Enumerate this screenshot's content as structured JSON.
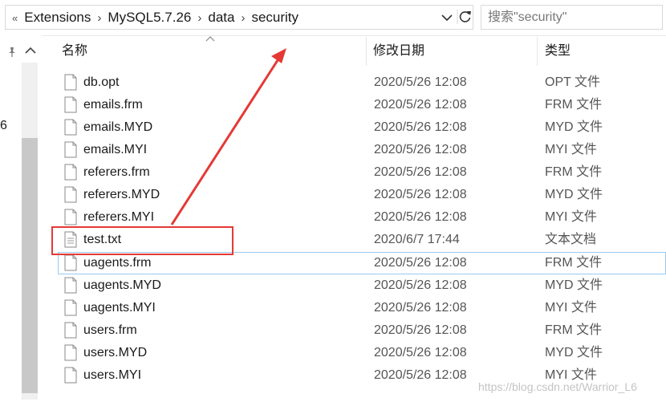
{
  "address_bar": {
    "lead_glyph": "«",
    "breadcrumbs": [
      "Extensions",
      "MySQL5.7.26",
      "data",
      "security"
    ]
  },
  "search": {
    "placeholder": "搜索\"security\""
  },
  "nav": {
    "fragment_text": "6"
  },
  "columns": {
    "name": "名称",
    "date": "修改日期",
    "type": "类型"
  },
  "files": [
    {
      "name": "db.opt",
      "date": "2020/5/26 12:08",
      "type": "OPT 文件",
      "icon": "file-icon"
    },
    {
      "name": "emails.frm",
      "date": "2020/5/26 12:08",
      "type": "FRM 文件",
      "icon": "file-icon"
    },
    {
      "name": "emails.MYD",
      "date": "2020/5/26 12:08",
      "type": "MYD 文件",
      "icon": "file-icon"
    },
    {
      "name": "emails.MYI",
      "date": "2020/5/26 12:08",
      "type": "MYI 文件",
      "icon": "file-icon"
    },
    {
      "name": "referers.frm",
      "date": "2020/5/26 12:08",
      "type": "FRM 文件",
      "icon": "file-icon"
    },
    {
      "name": "referers.MYD",
      "date": "2020/5/26 12:08",
      "type": "MYD 文件",
      "icon": "file-icon"
    },
    {
      "name": "referers.MYI",
      "date": "2020/5/26 12:08",
      "type": "MYI 文件",
      "icon": "file-icon"
    },
    {
      "name": "test.txt",
      "date": "2020/6/7 17:44",
      "type": "文本文档",
      "icon": "text-document-icon"
    },
    {
      "name": "uagents.frm",
      "date": "2020/5/26 12:08",
      "type": "FRM 文件",
      "icon": "file-icon"
    },
    {
      "name": "uagents.MYD",
      "date": "2020/5/26 12:08",
      "type": "MYD 文件",
      "icon": "file-icon"
    },
    {
      "name": "uagents.MYI",
      "date": "2020/5/26 12:08",
      "type": "MYI 文件",
      "icon": "file-icon"
    },
    {
      "name": "users.frm",
      "date": "2020/5/26 12:08",
      "type": "FRM 文件",
      "icon": "file-icon"
    },
    {
      "name": "users.MYD",
      "date": "2020/5/26 12:08",
      "type": "MYD 文件",
      "icon": "file-icon"
    },
    {
      "name": "users.MYI",
      "date": "2020/5/26 12:08",
      "type": "MYI 文件",
      "icon": "file-icon"
    }
  ],
  "watermark": "https://blog.csdn.net/Warrior_L6",
  "colors": {
    "annotation_red": "#e53935",
    "focus_outline": "#99c9ef"
  }
}
